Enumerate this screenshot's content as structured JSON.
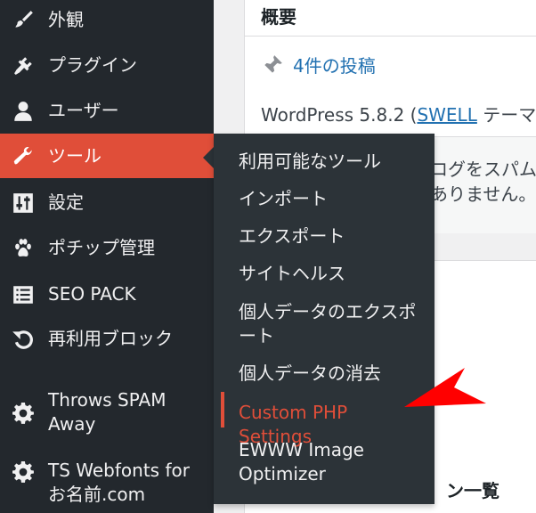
{
  "sidebar": {
    "items": [
      {
        "label": "外観",
        "icon": "paintbrush-icon"
      },
      {
        "label": "プラグイン",
        "icon": "plugin-icon"
      },
      {
        "label": "ユーザー",
        "icon": "user-icon"
      },
      {
        "label": "ツール",
        "icon": "wrench-icon",
        "active": true
      },
      {
        "label": "設定",
        "icon": "settings-sliders-icon"
      },
      {
        "label": "ポチップ管理",
        "icon": "paw-icon"
      },
      {
        "label": "SEO PACK",
        "icon": "list-icon"
      },
      {
        "label": "再利用ブロック",
        "icon": "undo-icon"
      },
      {
        "label": "Throws SPAM Away",
        "icon": "gear-icon"
      },
      {
        "label": "TS Webfonts for お名前.com",
        "icon": "gear-icon"
      }
    ]
  },
  "submenu": {
    "items": [
      {
        "label": "利用可能なツール"
      },
      {
        "label": "インポート"
      },
      {
        "label": "エクスポート"
      },
      {
        "label": "サイトヘルス"
      },
      {
        "label": "個人データのエクスポート"
      },
      {
        "label": "個人データの消去"
      },
      {
        "label": "Custom PHP Settings",
        "current": true
      },
      {
        "label": "EWWW Image Optimizer"
      }
    ]
  },
  "dashboard": {
    "title": "概要",
    "posts_link": "4件の投稿",
    "wp_version_prefix": "WordPress 5.8.2 (",
    "theme_name": "SWELL",
    "wp_version_suffix": " テーマ)",
    "spam_line1": "ログをスパム",
    "spam_line2": "ありません。",
    "list_heading": "ン一覧"
  },
  "colors": {
    "sidebar_bg": "#23282d",
    "active_bg": "#e04e39",
    "flyout_bg": "#2c3338",
    "link": "#2271b1",
    "annotation": "#ff0000"
  }
}
